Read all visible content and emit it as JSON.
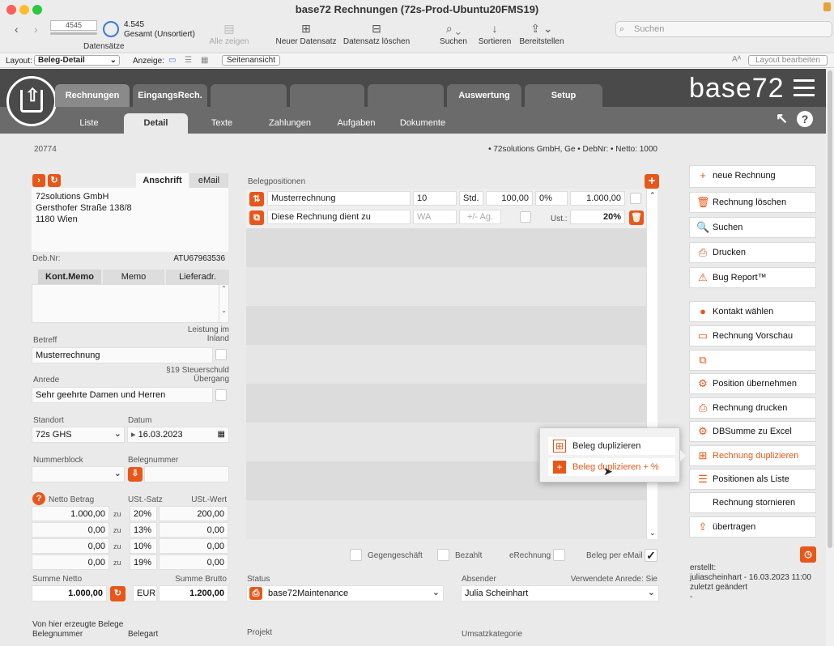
{
  "window": {
    "title": "base72 Rechnungen (72s-Prod-Ubuntu20FMS19)"
  },
  "toolbar": {
    "record_input": "4545",
    "record_count": "4.545",
    "record_state": "Gesamt (Unsortiert)",
    "records_label": "Datensätze",
    "show_all": "Alle zeigen",
    "new_record": "Neuer Datensatz",
    "delete_record": "Datensatz löschen",
    "find": "Suchen",
    "sort": "Sortieren",
    "share": "Bereitstellen",
    "search_placeholder": "Suchen"
  },
  "layoutbar": {
    "layout_label": "Layout:",
    "layout_value": "Beleg-Detail",
    "view_label": "Anzeige:",
    "page_view": "Seitenansicht",
    "edit_layout": "Layout bearbeiten"
  },
  "tabs": [
    "Rechnungen",
    "EingangsRech.",
    "",
    "",
    "",
    "Auswertung",
    "Setup"
  ],
  "subtabs": [
    "Liste",
    "Detail",
    "Texte",
    "Zahlungen",
    "Aufgaben",
    "Dokumente"
  ],
  "logo": "base72",
  "record": {
    "id": "20774",
    "summary": "• 72solutions GmbH, Ge • DebNr: • Netto: 1000"
  },
  "address": {
    "tab_address": "Anschrift",
    "tab_email": "eMail",
    "line1": "72solutions GmbH",
    "line2": "Gersthofer Straße 138/8",
    "line3": "1180 Wien",
    "debnr_label": "Deb.Nr:",
    "debnr_value": "ATU67963536"
  },
  "memo_tabs": [
    "Kont.Memo",
    "Memo",
    "Lieferadr."
  ],
  "fields": {
    "betreff_label": "Betreff",
    "betreff": "Musterrechnung",
    "leistung_label": "Leistung im Inland",
    "anrede_label": "Anrede",
    "anrede": "Sehr geehrte Damen und Herren",
    "steuerschuld_label": "§19 Steuerschuld Übergang",
    "standort_label": "Standort",
    "standort": "72s GHS",
    "datum_label": "Datum",
    "datum": "16.03.2023",
    "nummerblock_label": "Nummerblock",
    "belegnummer_label": "Belegnummer"
  },
  "vat": {
    "netto_label": "Netto Betrag",
    "satz_label": "USt.-Satz",
    "wert_label": "USt.-Wert",
    "rows": [
      {
        "netto": "1.000,00",
        "zu": "zu",
        "satz": "20%",
        "wert": "200,00"
      },
      {
        "netto": "0,00",
        "zu": "zu",
        "satz": "13%",
        "wert": "0,00"
      },
      {
        "netto": "0,00",
        "zu": "zu",
        "satz": "10%",
        "wert": "0,00"
      },
      {
        "netto": "0,00",
        "zu": "zu",
        "satz": "19%",
        "wert": "0,00"
      }
    ],
    "summe_netto_label": "Summe Netto",
    "summe_brutto_label": "Summe Brutto",
    "summe_netto": "1.000,00",
    "currency": "EUR",
    "summe_brutto": "1.200,00"
  },
  "bottom_left": {
    "erzeugt_label": "Von hier erzeugte Belege",
    "belegnummer": "Belegnummer",
    "belegart": "Belegart"
  },
  "positions": {
    "title": "Belegpositionen",
    "row1": {
      "name": "Musterrechnung",
      "qty": "10",
      "unit": "Std.",
      "price": "100,00",
      "disc": "0%",
      "total": "1.000,00"
    },
    "row2": {
      "name": "Diese Rechnung dient zu",
      "unit_ph": "WA",
      "ag_ph": "+/- Ag.",
      "ust_label": "Ust.:",
      "ust": "20%"
    }
  },
  "flags": {
    "gegen": "Gegengeschäft",
    "bezahlt": "Bezahlt",
    "erechnung": "eRechnung",
    "email": "Beleg per eMail"
  },
  "status": {
    "status_label": "Status",
    "status_value": "base72Maintenance",
    "absender_label": "Absender",
    "anrede_label": "Verwendete Anrede: Sie",
    "absender_value": "Julia Scheinhart",
    "projekt_label": "Projekt",
    "umsatz_label": "Umsatzkategorie"
  },
  "actions": [
    {
      "label": "neue Rechnung",
      "icon": "plus-icon",
      "glyph": "+"
    },
    {
      "label": "Rechnung löschen",
      "icon": "trash-icon",
      "glyph": "🗑"
    },
    {
      "label": "Suchen",
      "icon": "search-icon",
      "glyph": "🔍"
    },
    {
      "label": "Drucken",
      "icon": "printer-icon",
      "glyph": "⎙"
    },
    {
      "label": "Bug Report™",
      "icon": "warning-icon",
      "glyph": "⚠"
    },
    {
      "label": "Kontakt wählen",
      "icon": "contact-icon",
      "glyph": "●"
    },
    {
      "label": "Rechnung Vorschau",
      "icon": "document-icon",
      "glyph": "▭"
    },
    {
      "label": "",
      "icon": "duplicate-icon",
      "glyph": "⧉"
    },
    {
      "label": "Position übernehmen",
      "icon": "gear-icon",
      "glyph": "⚙"
    },
    {
      "label": "Rechnung drucken",
      "icon": "printer-icon",
      "glyph": "⎙"
    },
    {
      "label": "DBSumme zu Excel",
      "icon": "gear-icon",
      "glyph": "⚙"
    },
    {
      "label": "Rechnung duplizieren",
      "icon": "duplicate-icon",
      "glyph": "⊞"
    },
    {
      "label": "Positionen als Liste",
      "icon": "list-icon",
      "glyph": "☰"
    },
    {
      "label": "Rechnung stornieren",
      "icon": "",
      "glyph": ""
    },
    {
      "label": "übertragen",
      "icon": "share-icon",
      "glyph": "⇪"
    }
  ],
  "popup": {
    "item1": "Beleg duplizieren",
    "item2": "Beleg duplizieren + %"
  },
  "meta": {
    "created_label": "erstellt:",
    "created": "juliascheinhart - 16.03.2023 11:00",
    "changed_label": "zuletzt geändert",
    "changed": "-"
  }
}
